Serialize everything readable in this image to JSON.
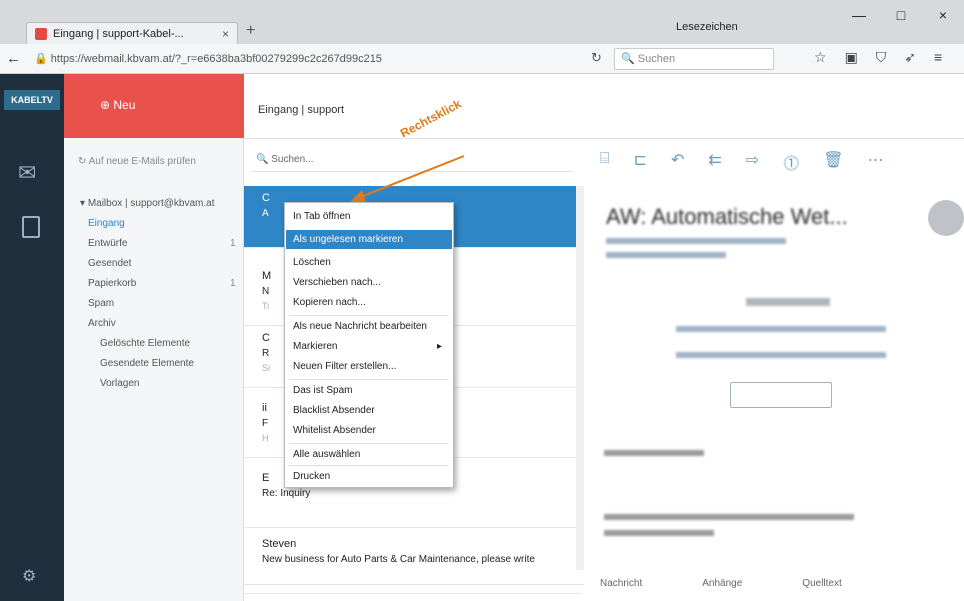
{
  "browser": {
    "tab_title": "Eingang | support-Kabel-...",
    "tab_close": "×",
    "new_tab": "+",
    "downloads_bookmarks": "Lesezeichen",
    "window_controls": [
      "—",
      "□",
      "×"
    ],
    "url": "https://webmail.kbvam.at/?_r=e6638ba3bf00279299c2c267d99c215",
    "search_placeholder": "Suchen",
    "nav_icons": [
      "star-icon",
      "clipboard-icon",
      "shield-icon",
      "pointer-icon",
      "menu-icon"
    ]
  },
  "app": {
    "logo": "KABELTV",
    "new_button": "Neu",
    "check_mail": "Auf neue E-Mails prüfen",
    "breadcrumb": "Eingang | support",
    "list_search_placeholder": "Suchen...",
    "account": "Mailbox | support@kbvam.at",
    "folders": [
      {
        "label": "Eingang",
        "count": ""
      },
      {
        "label": "Entwürfe",
        "count": "1"
      },
      {
        "label": "Gesendet",
        "count": ""
      },
      {
        "label": "Papierkorb",
        "count": "1"
      },
      {
        "label": "Spam",
        "count": ""
      },
      {
        "label": "Archiv",
        "count": ""
      },
      {
        "label": "Gelöschte Elemente",
        "count": ""
      },
      {
        "label": "Gesendete Elemente",
        "count": ""
      },
      {
        "label": "Vorlagen",
        "count": ""
      }
    ]
  },
  "messages": [
    {
      "from": "C",
      "date": "",
      "subject": "A",
      "preview": ""
    },
    {
      "from": "M",
      "date": "",
      "subject": "N",
      "preview": "Ti"
    },
    {
      "from": "C",
      "date": "",
      "subject": "R",
      "preview": "Si"
    },
    {
      "from": "ii",
      "date": "",
      "subject": "F",
      "preview": "H"
    },
    {
      "from": "E",
      "date": "",
      "subject": "Re: Inquiry",
      "preview": ""
    },
    {
      "from": "Steven",
      "date": "",
      "subject": "New business for Auto Parts & Car Maintenance, please write",
      "preview": ""
    }
  ],
  "context_menu": {
    "items": [
      "In Tab öffnen",
      "Als ungelesen markieren",
      "Löschen",
      "Verschieben nach...",
      "Kopieren nach...",
      "Als neue Nachricht bearbeiten",
      "Markieren",
      "Neuen Filter erstellen...",
      "Das ist Spam",
      "Blacklist Absender",
      "Whitelist Absender",
      "Alle auswählen",
      "Drucken"
    ],
    "selected_index": 1,
    "submenu_arrow": "▸"
  },
  "annotation": "Rechtsklick",
  "reading_pane": {
    "subject": "AW: Automatische Wet...",
    "tabs": [
      "Nachricht",
      "Anhänge",
      "Quelltext"
    ]
  },
  "colors": {
    "accent": "#e9524a",
    "selection": "#2f86c7",
    "rail": "#1e2f3d",
    "annotation": "#e07a1c"
  }
}
